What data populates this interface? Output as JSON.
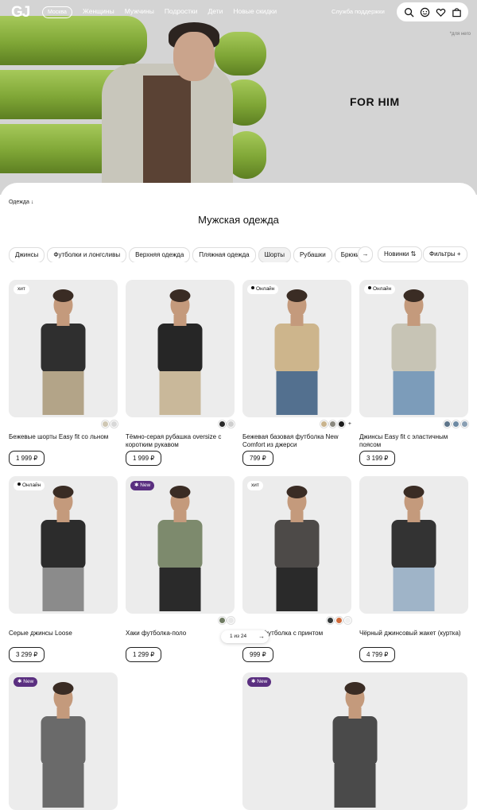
{
  "header": {
    "logo": "GJ",
    "city": "Москва",
    "nav": [
      "Женщины",
      "Мужчины",
      "Подростки",
      "Дети",
      "Новые скидки"
    ],
    "support": "Служба поддержки",
    "icons": [
      "search-icon",
      "smile-icon",
      "heart-icon",
      "bag-icon"
    ]
  },
  "hero": {
    "title": "FOR HIM",
    "note": "*для него"
  },
  "catalog": {
    "breadcrumb": "Одежда",
    "title": "Мужская одежда",
    "chips": [
      "Джинсы",
      "Футболки и лонгсливы",
      "Верхняя одежда",
      "Пляжная одежда",
      "Шорты",
      "Рубашки",
      "Брюки"
    ],
    "active_chip": "Шорты",
    "sort_label": "Новинки",
    "filters_label": "Фильтры"
  },
  "products": [
    {
      "badge": "хит",
      "name": "Бежевые шорты Easy fit со льном",
      "price": "1 999 ₽",
      "swatches": [
        "#cfc7b4",
        "#d8d8d8"
      ]
    },
    {
      "badge": "",
      "name": "Тёмно-серая рубашка oversize с коротким рукавом",
      "price": "1 999 ₽",
      "swatches": [
        "#2b2b2b",
        "#cfcfcf"
      ]
    },
    {
      "badge": "Онлайн",
      "name": "Бежевая базовая футболка New Comfort из джерси",
      "price": "799 ₽",
      "swatches": [
        "#c9b48e",
        "#8a887f",
        "#1c1c1c"
      ],
      "more": "+"
    },
    {
      "badge": "Онлайн",
      "name": "Джинсы Easy fit с эластичным поясом",
      "price": "3 199 ₽",
      "swatches": [
        "#5d7489",
        "#6e8aa3",
        "#8a9fb3"
      ]
    },
    {
      "badge": "Онлайн",
      "name": "Серые джинсы Loose",
      "price": "3 299 ₽",
      "swatches": []
    },
    {
      "badge": "New",
      "name": "Хаки футболка-поло",
      "price": "1 299 ₽",
      "swatches": [
        "#6f7b62",
        "#e8e8e8"
      ]
    },
    {
      "badge": "хит",
      "name": "Серая футболка с принтом",
      "price": "999 ₽",
      "swatches": [
        "#333838",
        "#d06a3a",
        "#f0f0f0"
      ]
    },
    {
      "badge": "",
      "name": "Чёрный джинсовый жакет (куртка)",
      "price": "4 799 ₽",
      "swatches": []
    },
    {
      "badge": "New",
      "name": "",
      "price": "",
      "swatches": []
    },
    {
      "badge": "New",
      "name": "",
      "price": "",
      "swatches": []
    }
  ],
  "pager": {
    "text": "1 из 24"
  },
  "colors": {
    "new_badge": "#5a2f80",
    "hero_bg": "#d4d4d4",
    "green": "#8db33f"
  }
}
